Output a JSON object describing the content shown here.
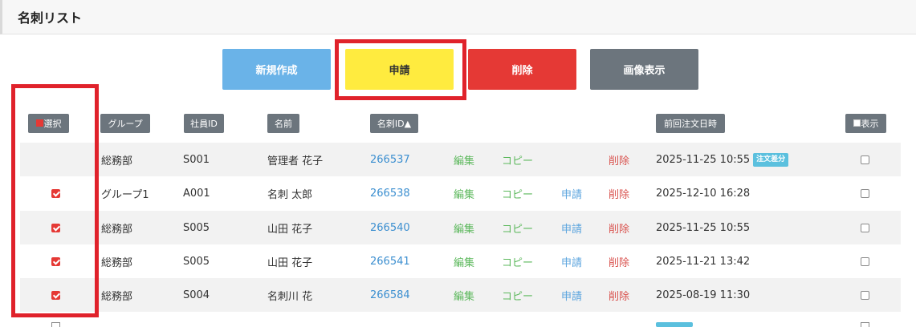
{
  "page": {
    "title": "名刺リスト"
  },
  "toolbar": {
    "new_label": "新規作成",
    "apply_label": "申請",
    "delete_label": "削除",
    "image_label": "画像表示"
  },
  "colors": {
    "new": "#6ab3e8",
    "apply": "#ffeb3f",
    "delete": "#e53935",
    "image": "#6c757d",
    "highlight": "#e0222b"
  },
  "table": {
    "headers": {
      "select": "選択",
      "group": "グループ",
      "emp_id": "社員ID",
      "name": "名前",
      "card_id": "名刺ID▲",
      "last_order": "前回注文日時",
      "show": "表示"
    },
    "rows": [
      {
        "selected": false,
        "group": "総務部",
        "emp_id": "S001",
        "name": "管理者 花子",
        "card_id": "266537",
        "edit": "編集",
        "copy": "コピー",
        "apply": "",
        "delete": "削除",
        "last_order": "2025-11-25 10:55",
        "badge": "注文差分",
        "show": false
      },
      {
        "selected": true,
        "group": "グループ1",
        "emp_id": "A001",
        "name": "名刺 太郎",
        "card_id": "266538",
        "edit": "編集",
        "copy": "コピー",
        "apply": "申請",
        "delete": "削除",
        "last_order": "2025-12-10 16:28",
        "badge": "",
        "show": false
      },
      {
        "selected": true,
        "group": "総務部",
        "emp_id": "S005",
        "name": "山田 花子",
        "card_id": "266540",
        "edit": "編集",
        "copy": "コピー",
        "apply": "申請",
        "delete": "削除",
        "last_order": "2025-11-25 10:55",
        "badge": "",
        "show": false
      },
      {
        "selected": true,
        "group": "総務部",
        "emp_id": "S005",
        "name": "山田 花子",
        "card_id": "266541",
        "edit": "編集",
        "copy": "コピー",
        "apply": "申請",
        "delete": "削除",
        "last_order": "2025-11-21 13:42",
        "badge": "",
        "show": false
      },
      {
        "selected": true,
        "group": "総務部",
        "emp_id": "S004",
        "name": "名刺川 花",
        "card_id": "266584",
        "edit": "編集",
        "copy": "コピー",
        "apply": "申請",
        "delete": "削除",
        "last_order": "2025-08-19 11:30",
        "badge": "",
        "show": false
      }
    ]
  }
}
